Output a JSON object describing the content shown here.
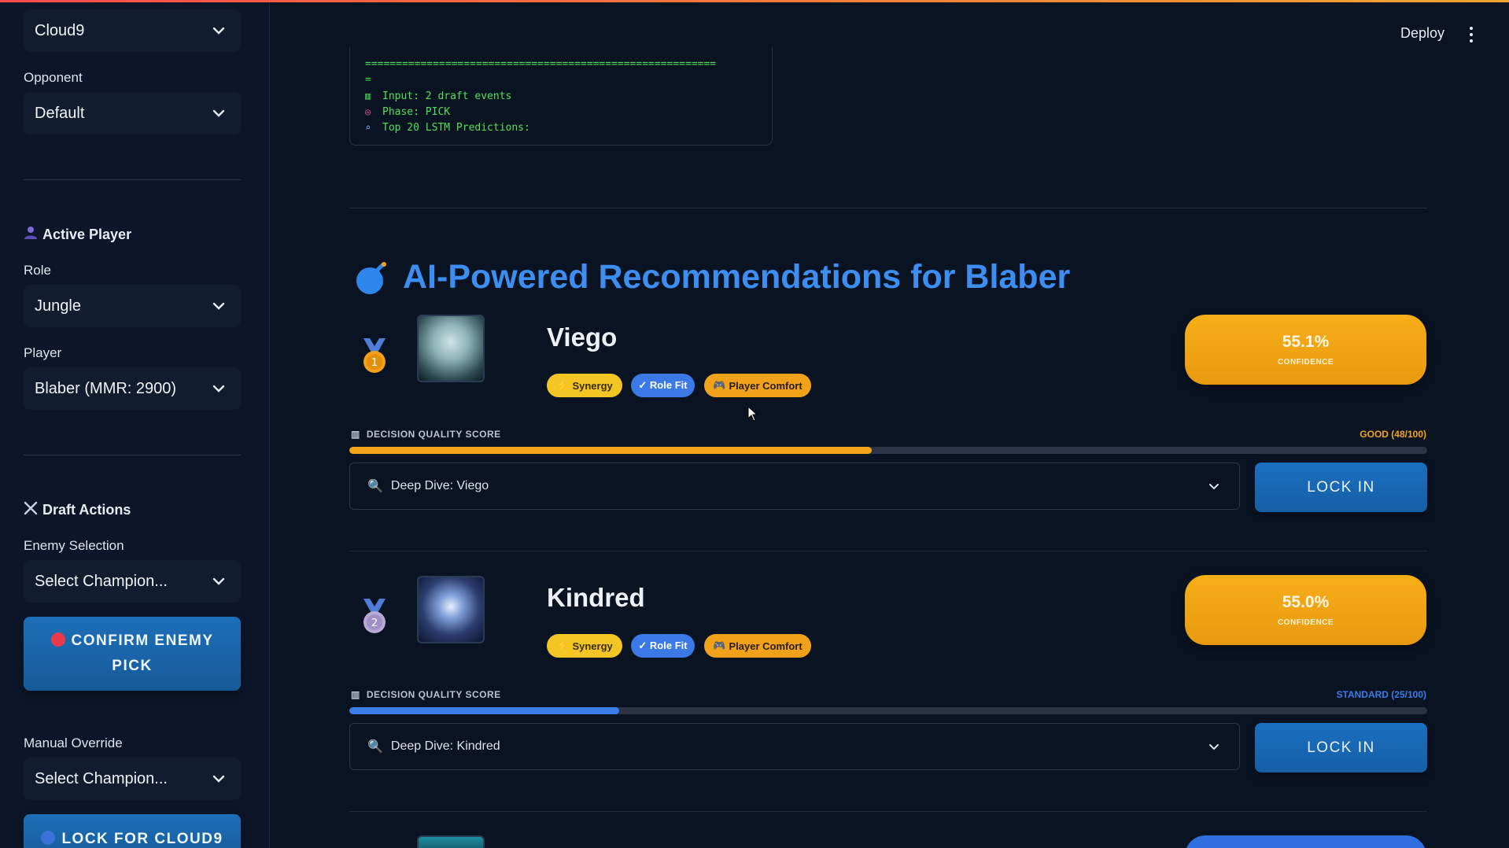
{
  "sidebar": {
    "team_select": "Cloud9",
    "opponent_label": "Opponent",
    "opponent_select": "Default",
    "active_player_heading": "Active Player",
    "role_label": "Role",
    "role_select": "Jungle",
    "player_label": "Player",
    "player_select": "Blaber (MMR: 2900)",
    "draft_actions_heading": "Draft Actions",
    "enemy_selection_label": "Enemy Selection",
    "enemy_select": "Select Champion...",
    "confirm_enemy_button": "CONFIRM ENEMY PICK",
    "manual_override_label": "Manual Override",
    "manual_select": "Select Champion...",
    "lock_for_button": "LOCK FOR CLOUD9"
  },
  "header": {
    "deploy_label": "Deploy"
  },
  "log": {
    "line1": "=========================================================",
    "line2": "=",
    "line3": "Input: 2 draft events",
    "line4": "Phase: PICK",
    "line5": "Top 20 LSTM Predictions:"
  },
  "recommendations": {
    "title": "AI-Powered Recommendations for Blaber",
    "items": [
      {
        "rank": "1",
        "champion": "Viego",
        "tags": {
          "synergy": "Synergy",
          "role_fit": "✓ Role Fit",
          "comfort": "Player Comfort"
        },
        "confidence": "55.1%",
        "confidence_label": "CONFIDENCE",
        "dqs_label": "DECISION QUALITY SCORE",
        "dqs_value": "GOOD (48/100)",
        "dqs_fraction": 0.485,
        "dqs_color": "#f2a41a",
        "deep_dive": "Deep Dive: Viego",
        "lock_label": "LOCK IN"
      },
      {
        "rank": "2",
        "champion": "Kindred",
        "tags": {
          "synergy": "Synergy",
          "role_fit": "✓ Role Fit",
          "comfort": "Player Comfort"
        },
        "confidence": "55.0%",
        "confidence_label": "CONFIDENCE",
        "dqs_label": "DECISION QUALITY SCORE",
        "dqs_value": "STANDARD (25/100)",
        "dqs_fraction": 0.25,
        "dqs_color": "#3a7de8",
        "deep_dive": "Deep Dive: Kindred",
        "lock_label": "LOCK IN"
      }
    ]
  },
  "colors": {
    "accent_blue": "#3d8ef0",
    "confidence_orange": "#f2a41a",
    "log_green": "#51e05c"
  }
}
